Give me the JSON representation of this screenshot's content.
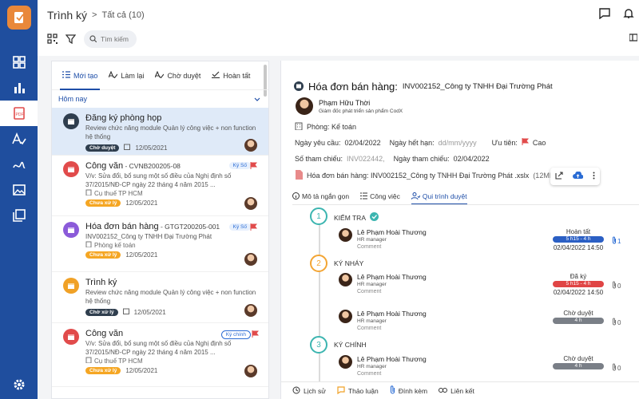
{
  "app": {
    "brand_color": "#1f4e9e",
    "accent_color": "#e9883a"
  },
  "breadcrumb": {
    "title": "Trình ký",
    "sep": ">",
    "filter": "Tất cả (10)"
  },
  "search": {
    "placeholder": "Tìm kiếm"
  },
  "list": {
    "tabs": [
      {
        "label": "Mới tạo",
        "icon": "list-icon"
      },
      {
        "label": "Làm lại",
        "icon": "sign-icon"
      },
      {
        "label": "Chờ duyệt",
        "icon": "sign-icon"
      },
      {
        "label": "Hoàn tất",
        "icon": "check-icon"
      }
    ],
    "group": "Hôm nay",
    "items": [
      {
        "title": "Đăng ký phòng họp",
        "code": "",
        "desc": "Review chức năng module Quản lý công việc + non function hệ thống",
        "org": "",
        "status": "Chờ duyệt",
        "date": "12/05/2021",
        "tag": "",
        "icon_color": "#2f3e4e"
      },
      {
        "title": "Công văn",
        "code": " - CVNB200205-08",
        "desc": "V/v: Sửa đổi, bổ sung một số điều của Nghị định số 37/2015/NĐ-CP ngày 22 tháng 4 năm 2015 ...",
        "org": "Cụ thuế TP HCM",
        "status": "Chưa xử lý",
        "date": "12/05/2021",
        "tag": "Ký Số",
        "icon_color": "#e14b4b"
      },
      {
        "title": "Hóa đơn bán hàng",
        "code": " - GTGT200205-001",
        "desc": "INV002152_Công ty TNHH Đại Trường Phát",
        "org": "Phòng kế toán",
        "status": "Chưa xử lý",
        "date": "12/05/2021",
        "tag": "Ký Số",
        "icon_color": "#8b5bd9"
      },
      {
        "title": "Trình ký",
        "code": "",
        "desc": "Review chức năng module Quản lý công việc + non function hệ thống",
        "org": "",
        "status": "Chờ xử lý",
        "date": "12/05/2021",
        "tag": "",
        "icon_color": "#f0a126"
      },
      {
        "title": "Công văn",
        "code": "",
        "desc": "V/v: Sửa đổi, bổ sung một số điều của Nghị định số 37/2015/NĐ-CP ngày 22 tháng 4 năm 2015 ...",
        "org": "Cụ thuế TP HCM",
        "status": "Chưa xử lý",
        "date": "12/05/2021",
        "tag": "Ký chính",
        "icon_color": "#e14b4b"
      }
    ]
  },
  "detail": {
    "title": "Hóa đơn bán hàng:",
    "title_sub": "INV002152_Công ty TNHH Đại Trường Phát",
    "person_name": "Phạm Hữu Thời",
    "person_role": "Giám đốc phát triển sản phẩm CodX",
    "dept": "Phòng: Kế toán",
    "req_label": "Ngày yêu cầu:",
    "req_val": "02/04/2022",
    "exp_label": "Ngày hết hạn:",
    "exp_val": "dd/mm/yyyy",
    "prio_label": "Ưu tiên:",
    "prio_val": "Cao",
    "ref_label": "Số tham chiếu:",
    "ref_val": "INV022442,",
    "refdate_label": "Ngày tham chiếu:",
    "refdate_val": "02/04/2022",
    "attach": "Hóa đơn bán hàng: INV002152_Công ty TNHH Đại Trường Phát .xslx",
    "attach_size": "(12MB)",
    "tabs": [
      "Mô tả ngắn gọn",
      "Công việc",
      "Qui trình duyệt"
    ],
    "steps": [
      {
        "num": "1",
        "label": "KIỂM TRA"
      },
      {
        "num": "2",
        "label": "KÝ NHÁY"
      },
      {
        "num": "3",
        "label": "KÝ CHÍNH"
      }
    ],
    "approvers": [
      {
        "name": "Lê Phạm Hoài Thương",
        "role": "HR manager",
        "comment": "Comment",
        "status": "Hoàn tất",
        "time": "5 h15 - 4 h",
        "date": "02/04/2022 14:50",
        "clips": "1",
        "pill_color": "#2b5fc4"
      },
      {
        "name": "Lê Phạm Hoài Thương",
        "role": "HR manager",
        "comment": "Comment",
        "status": "Đã ký",
        "time": "5 h15 - 4 h",
        "date": "02/04/2022 14:50",
        "clips": "0",
        "pill_color": "#e04545"
      },
      {
        "name": "Lê Phạm Hoài Thương",
        "role": "HR manager",
        "comment": "Comment",
        "status": "Chờ duyệt",
        "time": "4 h",
        "date": "",
        "clips": "0",
        "pill_color": "#7a7f87"
      },
      {
        "name": "Lê Phạm Hoài Thương",
        "role": "HR manager",
        "comment": "Comment",
        "status": "Chờ duyệt",
        "time": "4 h",
        "date": "",
        "clips": "0",
        "pill_color": "#7a7f87"
      }
    ],
    "bottom": [
      "Lịch sử",
      "Thảo luận",
      "Đính kèm",
      "Liên kết"
    ]
  }
}
